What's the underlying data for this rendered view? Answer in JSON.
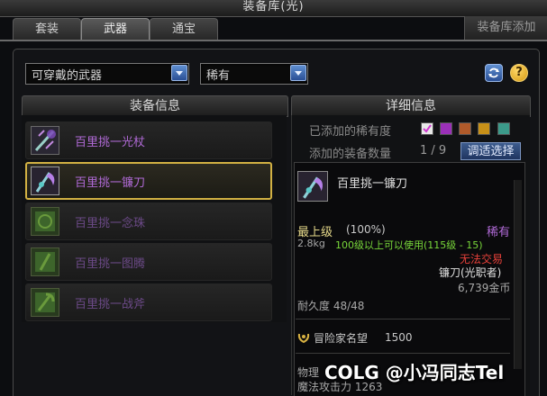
{
  "window": {
    "title": "装备库(光)"
  },
  "tabs": [
    {
      "label": "套装"
    },
    {
      "label": "武器"
    },
    {
      "label": "通宝"
    }
  ],
  "tab_right": {
    "label": "装备库添加"
  },
  "filters": {
    "category": {
      "selected": "可穿戴的武器"
    },
    "rarity": {
      "selected": "稀有"
    }
  },
  "left_panel": {
    "header": "装备信息",
    "items": [
      {
        "name": "百里挑一光杖",
        "state": "normal"
      },
      {
        "name": "百里挑一镰刀",
        "state": "selected"
      },
      {
        "name": "百里挑一念珠",
        "state": "dim"
      },
      {
        "name": "百里挑一图腾",
        "state": "dim"
      },
      {
        "name": "百里挑一战斧",
        "state": "dim"
      }
    ]
  },
  "right_panel": {
    "header": "详细信息",
    "rarity_label": "已添加的稀有度",
    "rarity_swatch_colors": [
      "#b0b0b0",
      "#9b30b8",
      "#b05a2a",
      "#c89018",
      "#3c9a8a"
    ],
    "count_label": "添加的装备数量",
    "count_value": "1 / 9",
    "select_button": "调适选择",
    "item": {
      "name": "百里挑一镰刀",
      "grade": "最上级",
      "grade_percent": "(100%)",
      "rarity": "稀有",
      "weight": "2.8kg",
      "requirement": "100级以上可以使用(115级 - 15)",
      "trade": "无法交易",
      "type": "镰刀(光职者)",
      "price": "6,739金币",
      "durability": "耐久度 48/48",
      "reputation_label": "冒险家名望",
      "reputation_value": "1500",
      "stat1": "物理",
      "stat2": "魔法攻击力 1263"
    }
  },
  "watermark": "COLG @小冯同志Tel",
  "colors": {
    "item_name_purple": "#b06ad6",
    "selected_border": "#d2b143",
    "requirement_green": "#79d83a",
    "trade_red": "#e8413a",
    "grade_yellow": "#e6d98a"
  }
}
